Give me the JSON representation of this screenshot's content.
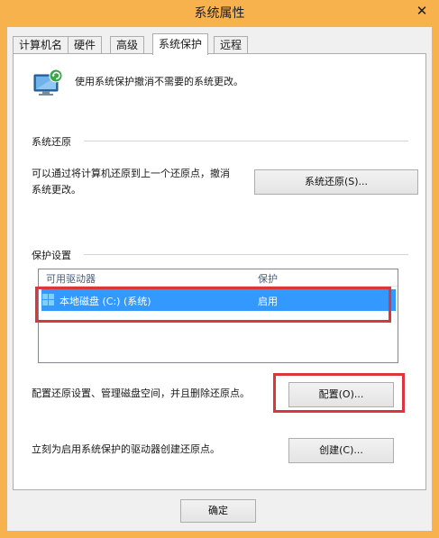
{
  "window": {
    "title": "系统属性",
    "close_glyph": "✕"
  },
  "tabs": [
    {
      "label": "计算机名",
      "active": false
    },
    {
      "label": "硬件",
      "active": false
    },
    {
      "label": "高级",
      "active": false
    },
    {
      "label": "系统保护",
      "active": true
    },
    {
      "label": "远程",
      "active": false
    }
  ],
  "header": {
    "text": "使用系统保护撤消不需要的系统更改。",
    "icon": "system-protection-icon"
  },
  "system_restore": {
    "group_label": "系统还原",
    "description_line1": "可以通过将计算机还原到上一个还原点，撤消",
    "description_line2": "系统更改。",
    "button_label": "系统还原(S)..."
  },
  "protection_settings": {
    "group_label": "保护设置",
    "columns": [
      "可用驱动器",
      "保护"
    ],
    "rows": [
      {
        "drive": "本地磁盘 (C:) (系统)",
        "protection": "启用",
        "selected": true,
        "icon": "windows-drive-icon"
      }
    ]
  },
  "configure": {
    "description": "配置还原设置、管理磁盘空间，并且删除还原点。",
    "button_label": "配置(O)..."
  },
  "create": {
    "description": "立刻为启用系统保护的驱动器创建还原点。",
    "button_label": "创建(C)..."
  },
  "footer": {
    "ok_label": "确定"
  },
  "colors": {
    "frame": "#f7b24d",
    "selection": "#3399ff",
    "highlight_box": "#d9363e"
  }
}
